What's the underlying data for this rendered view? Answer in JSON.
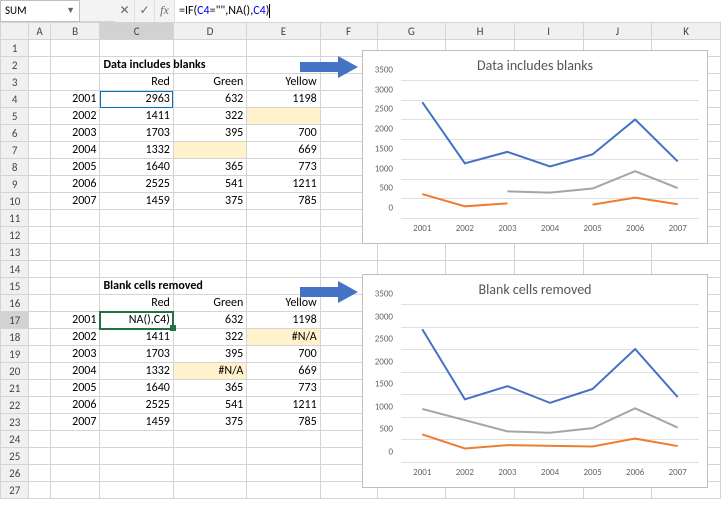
{
  "formula_bar": {
    "name_box": "SUM",
    "formula_parts": [
      {
        "t": "=IF(",
        "c": "black"
      },
      {
        "t": "C4",
        "c": "blue"
      },
      {
        "t": "=\"\",NA(),",
        "c": "black"
      },
      {
        "t": "C4",
        "c": "blue"
      },
      {
        "t": ")",
        "c": "black"
      }
    ]
  },
  "columns": [
    "A",
    "B",
    "C",
    "D",
    "E",
    "F",
    "G",
    "H",
    "I",
    "J",
    "K"
  ],
  "rows": [
    "1",
    "2",
    "3",
    "4",
    "5",
    "6",
    "7",
    "8",
    "9",
    "10",
    "11",
    "12",
    "13",
    "14",
    "15",
    "16",
    "17",
    "18",
    "19",
    "20",
    "21",
    "22",
    "23",
    "24",
    "25",
    "26",
    "27"
  ],
  "table1": {
    "title": "Data includes blanks",
    "headers": [
      "Red",
      "Green",
      "Yellow"
    ],
    "years": [
      "2001",
      "2002",
      "2003",
      "2004",
      "2005",
      "2006",
      "2007"
    ],
    "data": [
      {
        "red": "2963",
        "green": "632",
        "yellow": "1198",
        "hl": []
      },
      {
        "red": "1411",
        "green": "322",
        "yellow": "",
        "hl": [
          "yellow"
        ]
      },
      {
        "red": "1703",
        "green": "395",
        "yellow": "700",
        "hl": []
      },
      {
        "red": "1332",
        "green": "",
        "yellow": "669",
        "hl": [
          "green"
        ]
      },
      {
        "red": "1640",
        "green": "365",
        "yellow": "773",
        "hl": []
      },
      {
        "red": "2525",
        "green": "541",
        "yellow": "1211",
        "hl": []
      },
      {
        "red": "1459",
        "green": "375",
        "yellow": "785",
        "hl": []
      }
    ]
  },
  "table2": {
    "title": "Blank cells removed",
    "headers": [
      "Red",
      "Green",
      "Yellow"
    ],
    "years": [
      "2001",
      "2002",
      "2003",
      "2004",
      "2005",
      "2006",
      "2007"
    ],
    "data": [
      {
        "red": "NA(),C4)",
        "green": "632",
        "yellow": "1198",
        "hl": []
      },
      {
        "red": "1411",
        "green": "322",
        "yellow": "#N/A",
        "hl": [
          "yellow"
        ]
      },
      {
        "red": "1703",
        "green": "395",
        "yellow": "700",
        "hl": []
      },
      {
        "red": "1332",
        "green": "#N/A",
        "yellow": "669",
        "hl": [
          "green"
        ]
      },
      {
        "red": "1640",
        "green": "365",
        "yellow": "773",
        "hl": []
      },
      {
        "red": "2525",
        "green": "541",
        "yellow": "1211",
        "hl": []
      },
      {
        "red": "1459",
        "green": "375",
        "yellow": "785",
        "hl": []
      }
    ]
  },
  "chart1": {
    "title": "Data includes blanks",
    "y_ticks": [
      "0",
      "500",
      "1000",
      "1500",
      "2000",
      "2500",
      "3000",
      "3500"
    ],
    "x_ticks": [
      "2001",
      "2002",
      "2003",
      "2004",
      "2005",
      "2006",
      "2007"
    ]
  },
  "chart2": {
    "title": "Blank cells removed",
    "y_ticks": [
      "0",
      "500",
      "1000",
      "1500",
      "2000",
      "2500",
      "3000",
      "3500"
    ],
    "x_ticks": [
      "2001",
      "2002",
      "2003",
      "2004",
      "2005",
      "2006",
      "2007"
    ]
  },
  "active_cell": "C17",
  "chart_data": [
    {
      "type": "line",
      "title": "Data includes blanks",
      "xlabel": "",
      "ylabel": "",
      "ylim": [
        0,
        3500
      ],
      "categories": [
        "2001",
        "2002",
        "2003",
        "2004",
        "2005",
        "2006",
        "2007"
      ],
      "series": [
        {
          "name": "Red",
          "color": "#4472c4",
          "values": [
            2963,
            1411,
            1703,
            1332,
            1640,
            2525,
            1459
          ]
        },
        {
          "name": "Green",
          "color": "#ed7d31",
          "values": [
            632,
            322,
            395,
            null,
            365,
            541,
            375
          ]
        },
        {
          "name": "Yellow",
          "color": "#a5a5a5",
          "values": [
            1198,
            null,
            700,
            669,
            773,
            1211,
            785
          ]
        }
      ]
    },
    {
      "type": "line",
      "title": "Blank cells removed",
      "xlabel": "",
      "ylabel": "",
      "ylim": [
        0,
        3500
      ],
      "categories": [
        "2001",
        "2002",
        "2003",
        "2004",
        "2005",
        "2006",
        "2007"
      ],
      "series": [
        {
          "name": "Red",
          "color": "#4472c4",
          "values": [
            2963,
            1411,
            1703,
            1332,
            1640,
            2525,
            1459
          ]
        },
        {
          "name": "Green",
          "color": "#ed7d31",
          "values": [
            632,
            322,
            395,
            null,
            365,
            541,
            375
          ]
        },
        {
          "name": "Yellow",
          "color": "#a5a5a5",
          "values": [
            1198,
            null,
            700,
            669,
            773,
            1211,
            785
          ]
        }
      ],
      "interpolate_gaps": true
    }
  ]
}
